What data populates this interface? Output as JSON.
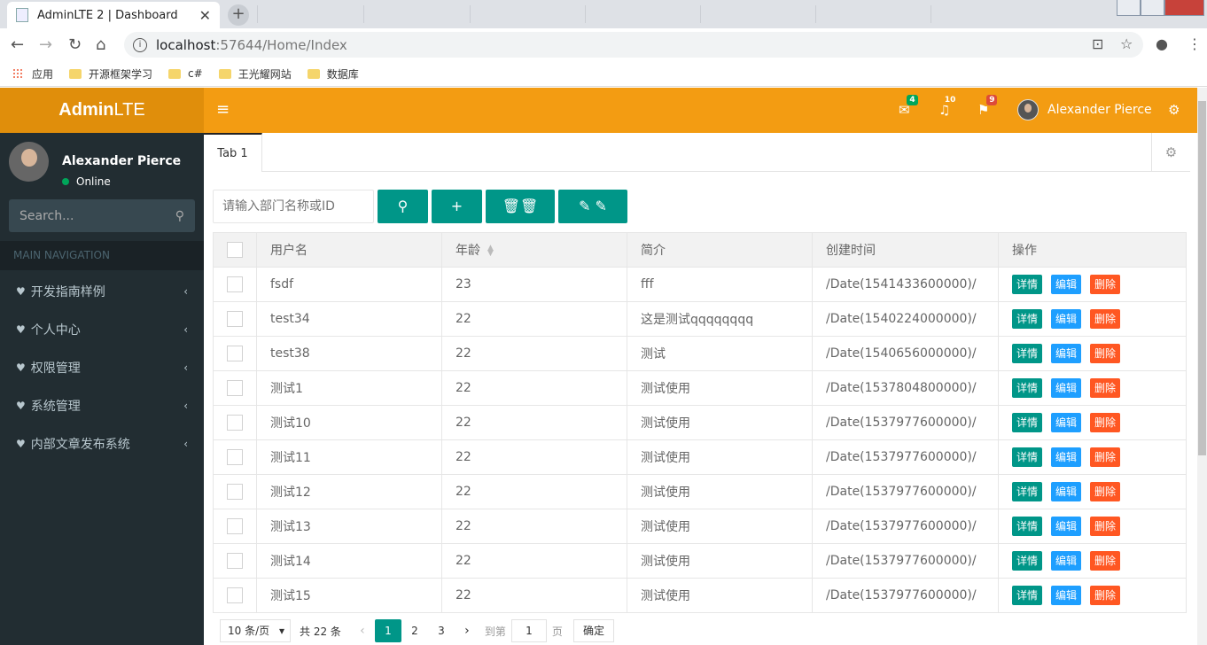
{
  "browser": {
    "tab_title": "AdminLTE 2 | Dashboard",
    "address_host": "localhost",
    "address_path": ":57644/Home/Index",
    "bookmarks": [
      "应用",
      "开源框架学习",
      "c#",
      "王光耀网站",
      "数据库"
    ]
  },
  "header": {
    "logo_bold": "Admin",
    "logo_light": "LTE",
    "mail_count": "4",
    "bell_count": "10",
    "flag_count": "9",
    "user_name": "Alexander Pierce",
    "colors": {
      "logo_bg": "#e08e0b",
      "navbar_bg": "#f39c12",
      "mail_badge": "#00a65a",
      "bell_badge": "#f39c12",
      "flag_badge": "#dd4b39"
    }
  },
  "sidebar": {
    "user_name": "Alexander Pierce",
    "status": "Online",
    "search_placeholder": "Search...",
    "nav_header": "MAIN NAVIGATION",
    "items": [
      {
        "label": "开发指南样例"
      },
      {
        "label": "个人中心"
      },
      {
        "label": "权限管理"
      },
      {
        "label": "系统管理"
      },
      {
        "label": "内部文章发布系统"
      }
    ]
  },
  "tabs": {
    "tab1": "Tab 1"
  },
  "toolbar": {
    "search_placeholder": "请输入部门名称或ID"
  },
  "table": {
    "headers": {
      "username": "用户名",
      "age": "年龄",
      "intro": "简介",
      "created": "创建时间",
      "ops": "操作"
    },
    "op_labels": {
      "detail": "详情",
      "edit": "编辑",
      "delete": "删除"
    },
    "rows": [
      {
        "username": "fsdf",
        "age": "23",
        "intro": "fff",
        "created": "/Date(1541433600000)/"
      },
      {
        "username": "test34",
        "age": "22",
        "intro": "这是测试qqqqqqqq",
        "created": "/Date(1540224000000)/"
      },
      {
        "username": "test38",
        "age": "22",
        "intro": "测试",
        "created": "/Date(1540656000000)/"
      },
      {
        "username": "测试1",
        "age": "22",
        "intro": "测试使用",
        "created": "/Date(1537804800000)/"
      },
      {
        "username": "测试10",
        "age": "22",
        "intro": "测试使用",
        "created": "/Date(1537977600000)/"
      },
      {
        "username": "测试11",
        "age": "22",
        "intro": "测试使用",
        "created": "/Date(1537977600000)/"
      },
      {
        "username": "测试12",
        "age": "22",
        "intro": "测试使用",
        "created": "/Date(1537977600000)/"
      },
      {
        "username": "测试13",
        "age": "22",
        "intro": "测试使用",
        "created": "/Date(1537977600000)/"
      },
      {
        "username": "测试14",
        "age": "22",
        "intro": "测试使用",
        "created": "/Date(1537977600000)/"
      },
      {
        "username": "测试15",
        "age": "22",
        "intro": "测试使用",
        "created": "/Date(1537977600000)/"
      }
    ]
  },
  "pager": {
    "limit": "10 条/页",
    "total": "共 22 条",
    "pages": [
      "1",
      "2",
      "3"
    ],
    "goto_label": "到第",
    "goto_value": "1",
    "page_unit": "页",
    "confirm": "确定"
  }
}
